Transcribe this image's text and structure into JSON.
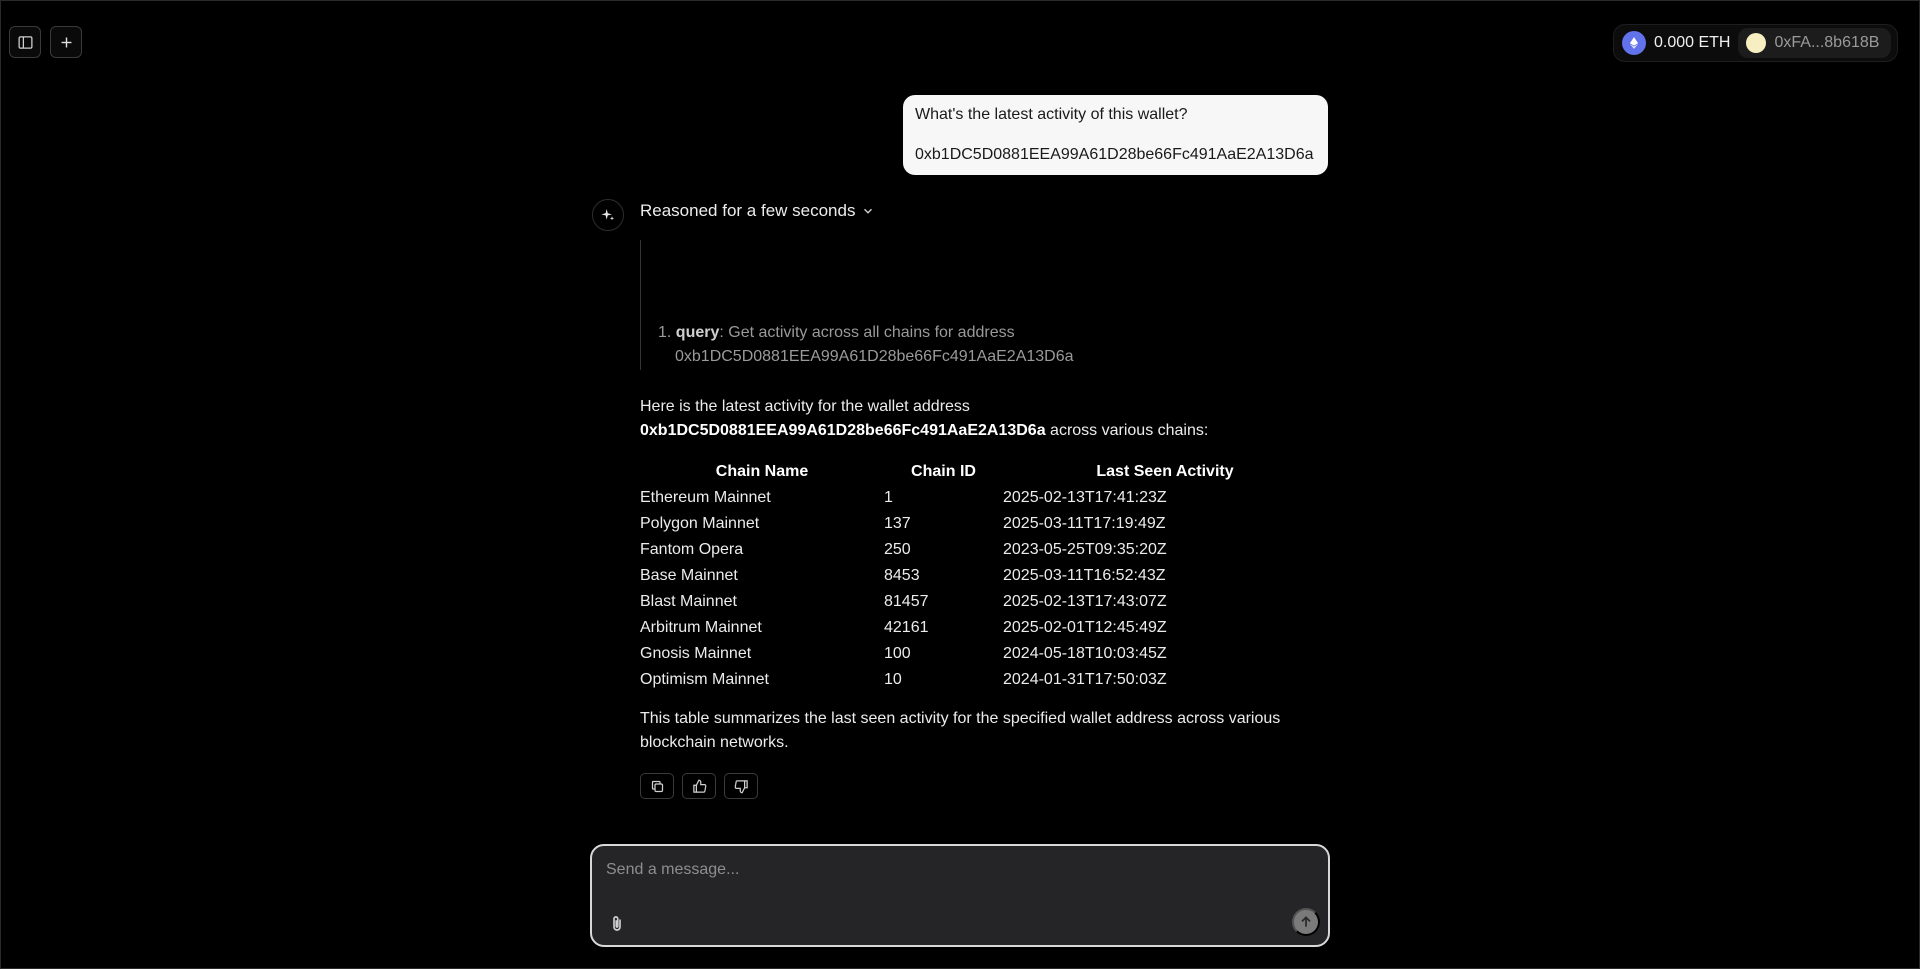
{
  "header": {
    "sidebar_toggle_icon": "sidebar-toggle-icon",
    "new_chat_icon": "plus-icon",
    "wallet": {
      "balance": "0.000 ETH",
      "address": "0xFA...8b618B"
    }
  },
  "user_message": {
    "line1": "What's the latest activity of this wallet?",
    "line2": "0xb1DC5D0881EEA99A61D28be66Fc491AaE2A13D6a"
  },
  "assistant": {
    "reasoned_label": "Reasoned for a few seconds",
    "reasoning_item": {
      "number": "1.",
      "key": "query",
      "text": ": Get activity across all chains for address",
      "address": "0xb1DC5D0881EEA99A61D28be66Fc491AaE2A13D6a"
    },
    "intro": {
      "line1": "Here is the latest activity for the wallet address",
      "address": "0xb1DC5D0881EEA99A61D28be66Fc491AaE2A13D6a",
      "suffix": " across various chains:"
    },
    "table": {
      "headers": [
        "Chain Name",
        "Chain ID",
        "Last Seen Activity"
      ],
      "rows": [
        [
          "Ethereum Mainnet",
          "1",
          "2025-02-13T17:41:23Z"
        ],
        [
          "Polygon Mainnet",
          "137",
          "2025-03-11T17:19:49Z"
        ],
        [
          "Fantom Opera",
          "250",
          "2023-05-25T09:35:20Z"
        ],
        [
          "Base Mainnet",
          "8453",
          "2025-03-11T16:52:43Z"
        ],
        [
          "Blast Mainnet",
          "81457",
          "2025-02-13T17:43:07Z"
        ],
        [
          "Arbitrum Mainnet",
          "42161",
          "2025-02-01T12:45:49Z"
        ],
        [
          "Gnosis Mainnet",
          "100",
          "2024-05-18T10:03:45Z"
        ],
        [
          "Optimism Mainnet",
          "10",
          "2024-01-31T17:50:03Z"
        ]
      ]
    },
    "summary": "This table summarizes the last seen activity for the specified wallet address across various blockchain networks.",
    "actions": [
      "copy-icon",
      "thumbs-up-icon",
      "thumbs-down-icon"
    ]
  },
  "composer": {
    "placeholder": "Send a message...",
    "value": ""
  },
  "colors": {
    "background": "#000000",
    "bubble": "#f7f7f7",
    "composer_bg": "#252527",
    "eth": "#6272ea",
    "avatar": "#f7eec1"
  }
}
